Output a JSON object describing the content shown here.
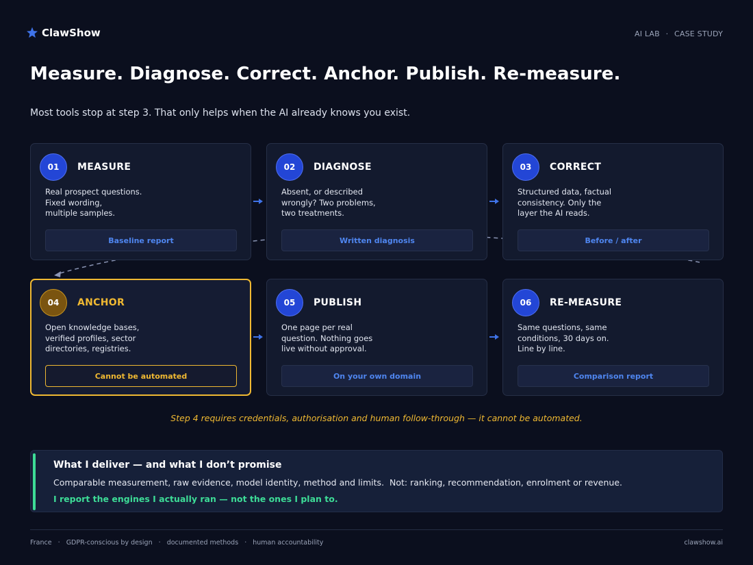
{
  "header": {
    "brand": "ClawShow",
    "tagline_left": "AI LAB",
    "tagline_sep": "·",
    "tagline_right": "CASE STUDY"
  },
  "headline": "Measure. Diagnose. Correct. Anchor. Publish. Re-measure.",
  "subhead": "Most tools stop at step 3. That only helps when the AI already knows you exist.",
  "steps": [
    {
      "num": "01",
      "title": "MEASURE",
      "lines": [
        "Real prospect questions.",
        "Fixed wording,",
        "multiple samples."
      ],
      "pill": "Baseline report"
    },
    {
      "num": "02",
      "title": "DIAGNOSE",
      "lines": [
        "Absent, or described",
        "wrongly? Two problems,",
        "two treatments."
      ],
      "pill": "Written diagnosis"
    },
    {
      "num": "03",
      "title": "CORRECT",
      "lines": [
        "Structured data, factual",
        "consistency. Only the",
        "layer the AI reads."
      ],
      "pill": "Before / after"
    },
    {
      "num": "04",
      "title": "ANCHOR",
      "lines": [
        "Open knowledge bases,",
        "verified profiles, sector",
        "directories, registries."
      ],
      "pill": "Cannot be automated"
    },
    {
      "num": "05",
      "title": "PUBLISH",
      "lines": [
        "One page per real",
        "question. Nothing goes",
        "live without approval."
      ],
      "pill": "On your own domain"
    },
    {
      "num": "06",
      "title": "RE-MEASURE",
      "lines": [
        "Same questions, same",
        "conditions, 30 days on.",
        "Line by line."
      ],
      "pill": "Comparison report"
    }
  ],
  "note": "Step 4 requires credentials, authorisation and human follow-through — it cannot be automated.",
  "deliver": {
    "title": "What I deliver — and what I don’t promise",
    "body": "Comparable measurement, raw evidence, model identity, method and limits.  Not: ranking, recommendation, enrolment or revenue.",
    "emphasis": "I report the engines I actually ran — not the ones I plan to."
  },
  "footer": {
    "items": [
      "France",
      "GDPR-conscious by design",
      "documented methods",
      "human accountability"
    ],
    "sep": "·",
    "site": "clawshow.ai"
  },
  "colors": {
    "background": "#0b0f1e",
    "accent_blue": "#2346d6",
    "link_blue": "#4f86f0",
    "highlight_gold": "#f0b932",
    "accent_green": "#3ddc97"
  },
  "icons": {
    "brand": "star-icon",
    "flow": "arrow-right-icon"
  }
}
